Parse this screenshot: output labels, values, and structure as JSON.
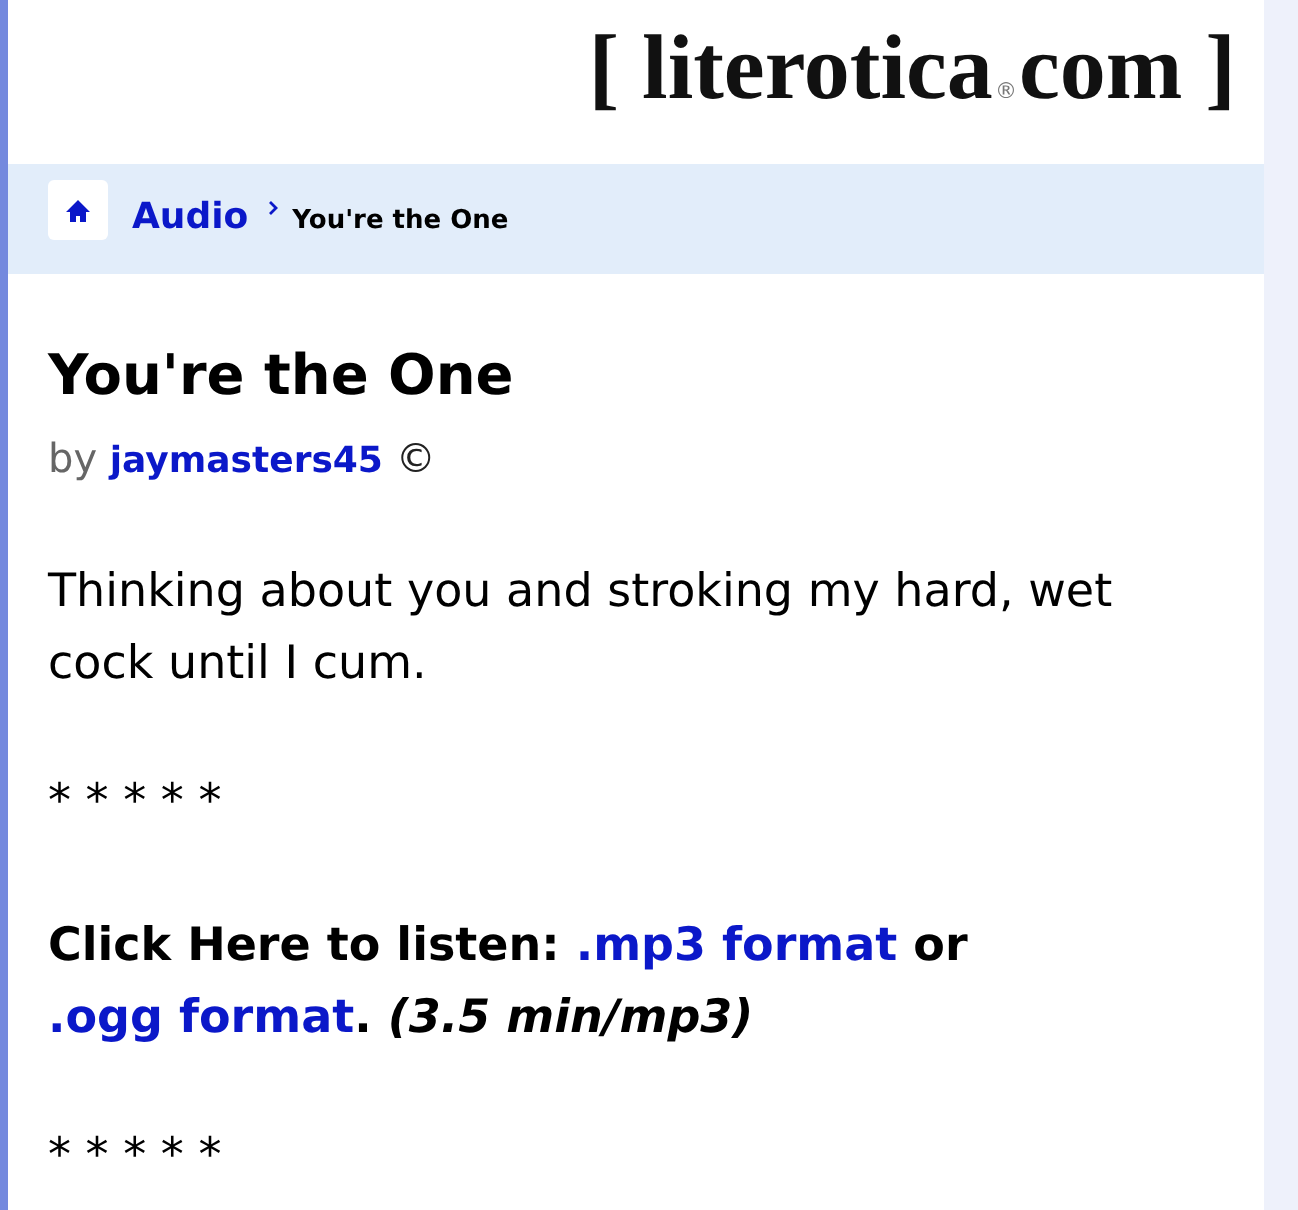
{
  "header": {
    "logo": {
      "brand": "[ literotica",
      "mark": "®",
      "tld": "com ]"
    }
  },
  "breadcrumb": {
    "items": [
      {
        "kind": "home"
      },
      {
        "kind": "link",
        "label": "Audio"
      },
      {
        "kind": "current",
        "label": "You're the One"
      }
    ]
  },
  "story": {
    "title": "You're the One",
    "byline": {
      "prefix": "by",
      "author": "jaymasters45",
      "mark": "©"
    },
    "blocks": [
      {
        "kind": "text",
        "text": "Thinking about you and stroking my hard, wet cock until I cum."
      },
      {
        "kind": "divider",
        "text": "* * * * *"
      },
      {
        "kind": "listen",
        "segments": [
          {
            "kind": "text",
            "text": "Click Here to listen: "
          },
          {
            "kind": "link",
            "text": ".mp3 format"
          },
          {
            "kind": "text",
            "text": " or "
          },
          {
            "kind": "link",
            "text": ".ogg format"
          },
          {
            "kind": "text",
            "text": ". "
          },
          {
            "kind": "note",
            "text": "(3.5 min/mp3)"
          }
        ]
      },
      {
        "kind": "divider",
        "text": "* * * * *"
      }
    ]
  }
}
